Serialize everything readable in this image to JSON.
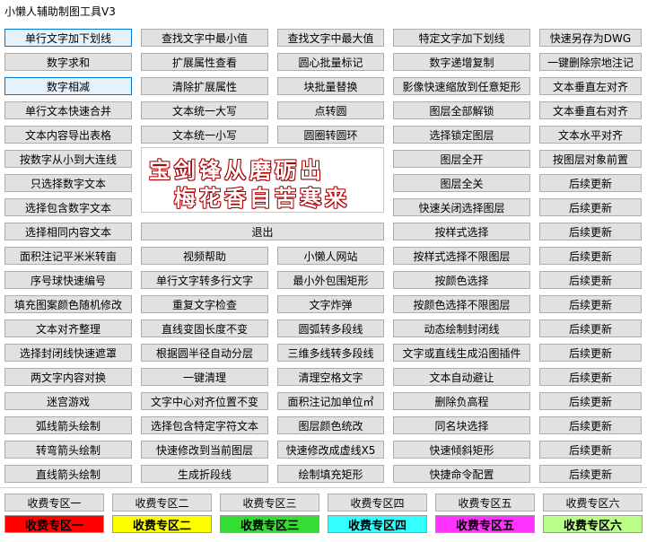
{
  "window": {
    "title": "小懒人辅助制图工具V3"
  },
  "col1": [
    "单行文字加下划线",
    "数字求和",
    "数字相减",
    "单行文本快速合并",
    "文本内容导出表格",
    "按数字从小到大连线",
    "只选择数字文本",
    "选择包含数字文本",
    "选择相同内容文本",
    "面积注记平米米转亩",
    "序号球快速编号",
    "填充图案颜色随机修改",
    "文本对齐整理",
    "选择封闭线快速遮罩",
    "两文字内容对换",
    "迷宫游戏",
    "弧线箭头绘制",
    "转弯箭头绘制",
    "直线箭头绘制"
  ],
  "col2": [
    "查找文字中最小值",
    "扩展属性查看",
    "清除扩展属性",
    "文本统一大写",
    "文本统一小写"
  ],
  "col3": [
    "查找文字中最大值",
    "圆心批量标记",
    "块批量替换",
    "点转圆",
    "圆圈转圆环"
  ],
  "col4": [
    "特定文字加下划线",
    "数字递增复制",
    "影像快速缩放到任意矩形",
    "图层全部解锁",
    "选择锁定图层",
    "图层全开",
    "图层全关",
    "快速关闭选择图层",
    "按样式选择",
    "按样式选择不限图层",
    "按颜色选择",
    "按颜色选择不限图层",
    "动态绘制封闭线",
    "文字或直线生成沿图插件",
    "文本自动避让",
    "删除负高程",
    "同名块选择",
    "快速倾斜矩形",
    "快捷命令配置"
  ],
  "col5": [
    "快速另存为DWG",
    "一键删除宗地注记",
    "文本垂直左对齐",
    "文本垂直右对齐",
    "文本水平对齐",
    "按图层对象前置",
    "后续更新",
    "后续更新",
    "后续更新",
    "后续更新",
    "后续更新",
    "后续更新",
    "后续更新",
    "后续更新",
    "后续更新",
    "后续更新",
    "后续更新",
    "后续更新",
    "后续更新"
  ],
  "exit_label": "退出",
  "grid2": [
    [
      "视频帮助",
      "小懒人网站"
    ],
    [
      "单行文字转多行文字",
      "最小外包围矩形"
    ],
    [
      "重复文字检查",
      "文字炸弹"
    ],
    [
      "直线变固长度不变",
      "圆弧转多段线"
    ],
    [
      "根据圆半径自动分层",
      "三维多线转多段线"
    ],
    [
      "一键清理",
      "清理空格文字"
    ],
    [
      "文字中心对齐位置不变",
      "面积注记加单位㎡"
    ],
    [
      "选择包含特定字符文本",
      "图层颜色统改"
    ],
    [
      "快速修改到当前图层",
      "快速修改成虚线X5"
    ],
    [
      "生成折段线",
      "绘制填充矩形"
    ]
  ],
  "banner": {
    "line1": "宝剑锋从磨砺出",
    "line2": "梅花香自苦寒来"
  },
  "paid_buttons": [
    "收费专区一",
    "收费专区二",
    "收费专区三",
    "收费专区四",
    "收费专区五",
    "收费专区六"
  ],
  "paid_zones": [
    {
      "label": "收费专区一",
      "color": "#ff0000"
    },
    {
      "label": "收费专区二",
      "color": "#ffff00"
    },
    {
      "label": "收费专区三",
      "color": "#33dd33"
    },
    {
      "label": "收费专区四",
      "color": "#33ffff"
    },
    {
      "label": "收费专区五",
      "color": "#ff33ff"
    },
    {
      "label": "收费专区六",
      "color": "#bbff88"
    }
  ]
}
